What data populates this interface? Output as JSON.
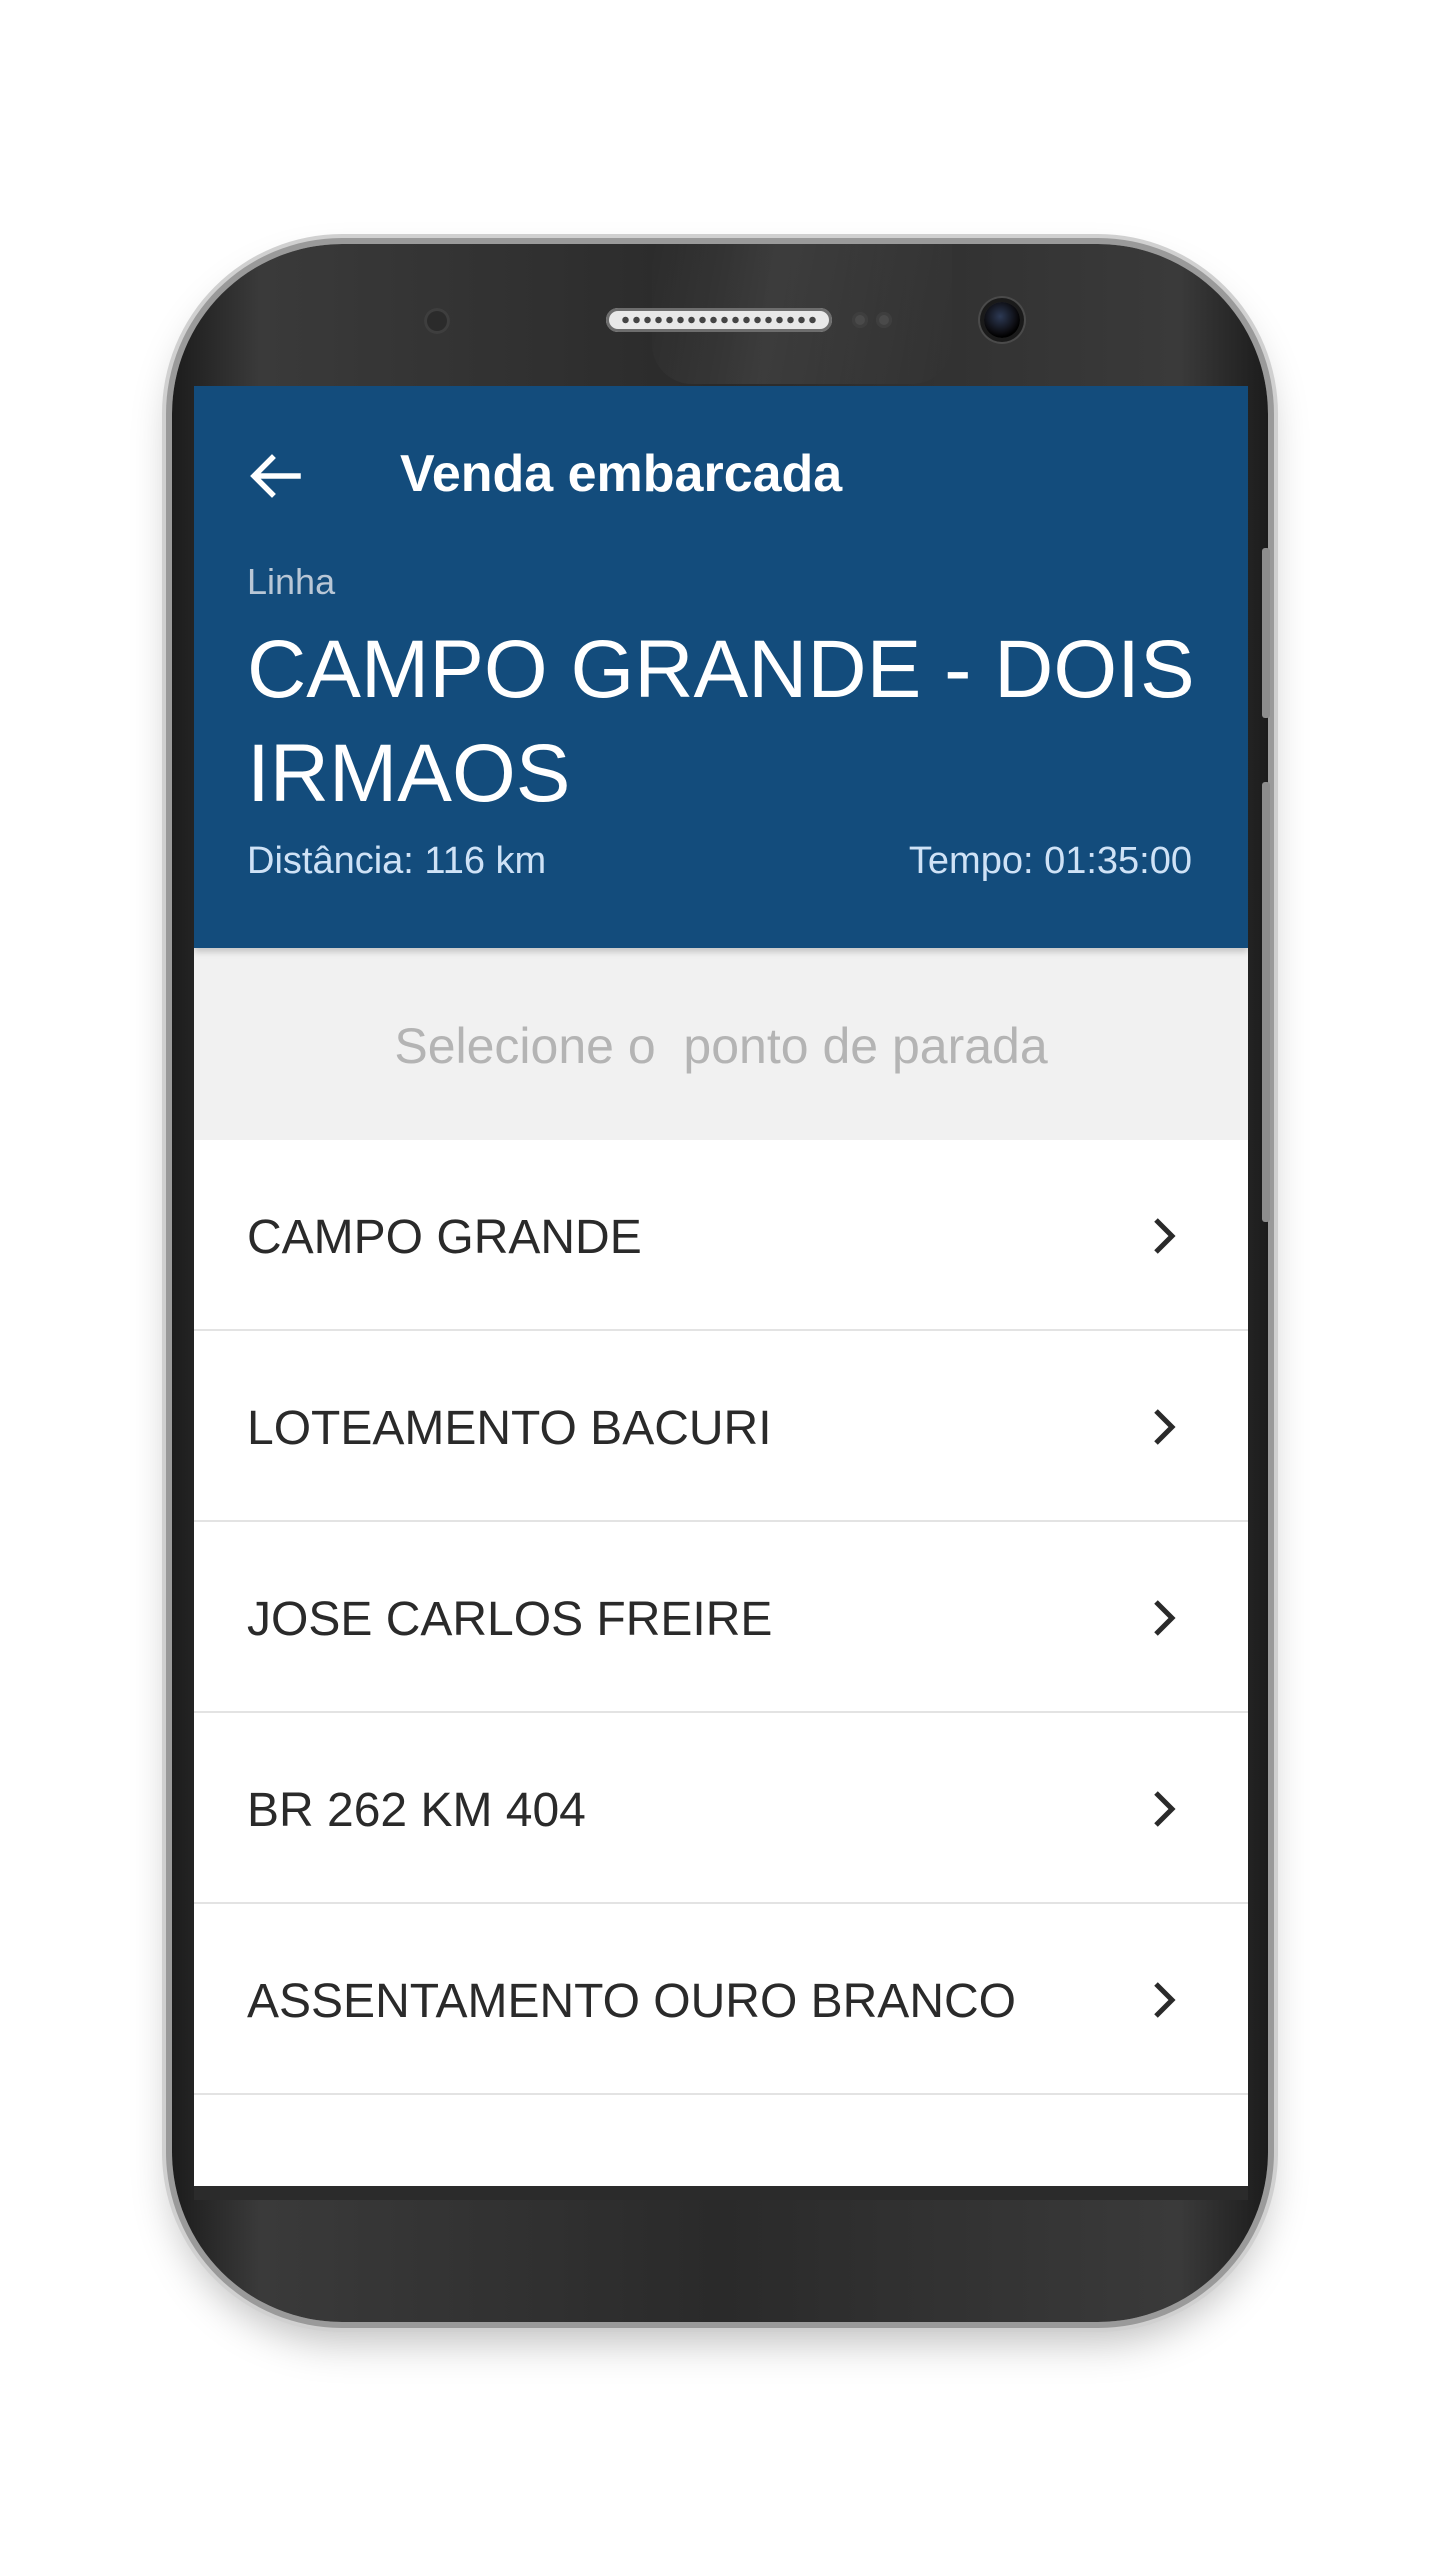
{
  "header": {
    "title": "Venda embarcada",
    "back_icon": "arrow-left-icon",
    "background_color": "#134c7c"
  },
  "route": {
    "line_label": "Linha",
    "line_name": "CAMPO GRANDE - DOIS IRMAOS",
    "distance": "Distância: 116 km",
    "time": "Tempo: 01:35:00"
  },
  "instruction": {
    "text": "Selecione o  ponto de parada"
  },
  "stops": [
    {
      "label": "CAMPO GRANDE",
      "icon": "chevron-right-icon"
    },
    {
      "label": "LOTEAMENTO BACURI",
      "icon": "chevron-right-icon"
    },
    {
      "label": "JOSE CARLOS FREIRE",
      "icon": "chevron-right-icon"
    },
    {
      "label": "BR 262 KM 404",
      "icon": "chevron-right-icon"
    },
    {
      "label": "ASSENTAMENTO OURO BRANCO",
      "icon": "chevron-right-icon"
    },
    {
      "label": "",
      "icon": ""
    }
  ]
}
